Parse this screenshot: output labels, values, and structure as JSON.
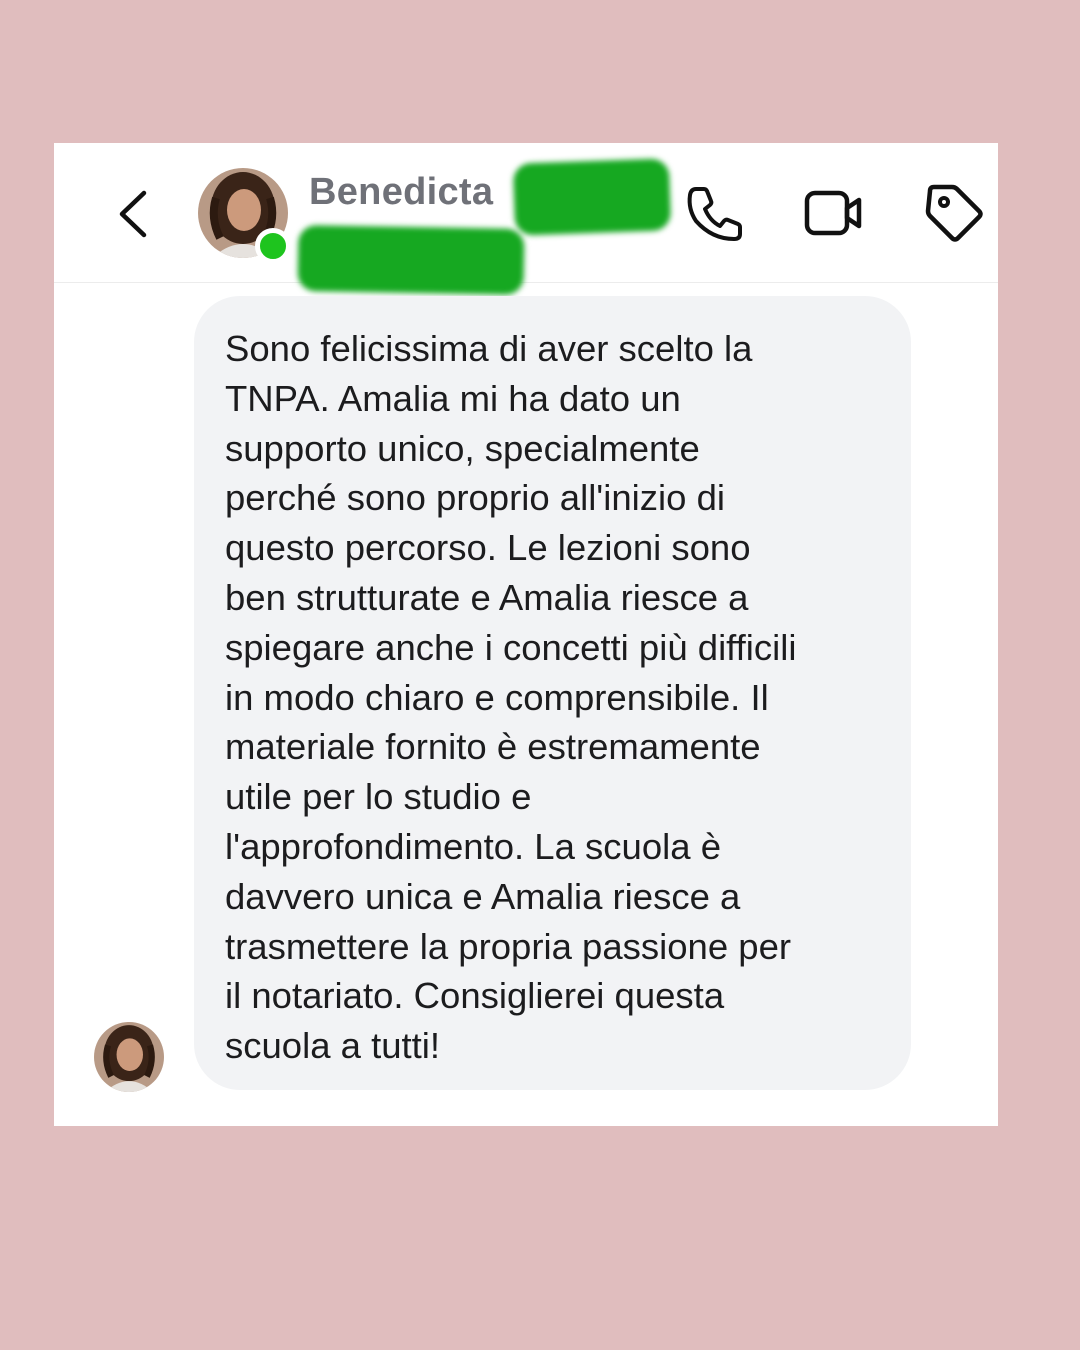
{
  "header": {
    "contact_name": "Benedicta",
    "status": "online",
    "back_icon": "chevron-left-icon",
    "call_icon": "phone-icon",
    "video_icon": "video-camera-icon",
    "tag_icon": "tag-icon",
    "redaction_color": "#16a821"
  },
  "message": {
    "text": "Sono felicissima di aver scelto la\nTNPA. Amalia mi ha dato un\nsupporto unico, specialmente\nperché sono proprio all'inizio di\nquesto percorso. Le lezioni sono\nben strutturate e Amalia riesce a\nspiegare anche i concetti più difficili\nin modo chiaro e comprensibile. Il\nmateriale fornito è estremamente\nutile per lo studio e\nl'approfondimento. La scuola è\ndavvero unica e Amalia riesce a\ntrasmettere la propria passione per\nil notariato. Consiglierei questa\nscuola a tutti!"
  },
  "colors": {
    "page_background": "#e0bdbe",
    "bubble_background": "#f2f3f5",
    "online_indicator": "#1ec41e"
  }
}
